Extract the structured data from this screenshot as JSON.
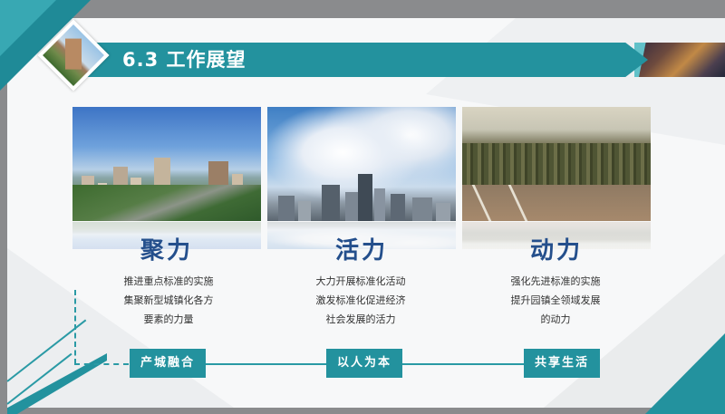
{
  "header": {
    "title": "6.3 工作展望"
  },
  "colors": {
    "accent": "#23929e",
    "heading": "#244f8c",
    "frame": "#8a8b8d"
  },
  "columns": [
    {
      "heading": "聚力",
      "lines": [
        "推进重点标准的实施",
        "集聚新型城镇化各方",
        "要素的力量"
      ],
      "tag": "产城融合"
    },
    {
      "heading": "活力",
      "lines": [
        "大力开展标准化活动",
        "激发标准化促进经济",
        "社会发展的活力"
      ],
      "tag": "以人为本"
    },
    {
      "heading": "动力",
      "lines": [
        "强化先进标准的实施",
        "提升园镇全领域发展",
        "的动力"
      ],
      "tag": "共享生活"
    }
  ]
}
